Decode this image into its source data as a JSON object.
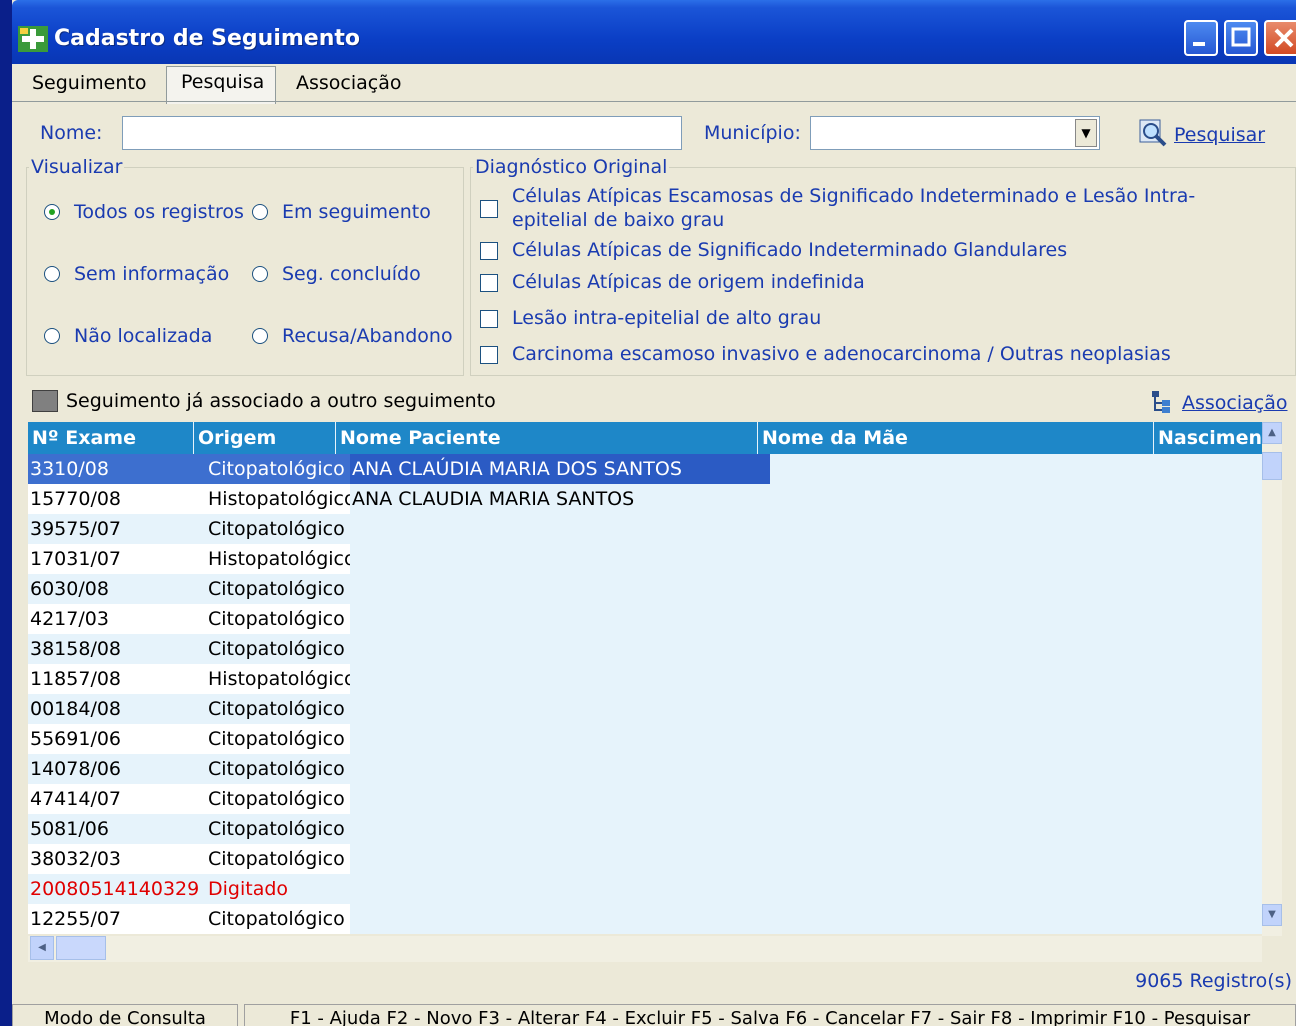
{
  "window": {
    "title": "Cadastro de Seguimento"
  },
  "tabs": [
    {
      "label": "Seguimento",
      "active": false
    },
    {
      "label": "Pesquisa",
      "active": true
    },
    {
      "label": "Associação",
      "active": false
    }
  ],
  "search": {
    "name_label": "Nome:",
    "name_value": "",
    "municipio_label": "Município:",
    "municipio_value": "",
    "search_button": "Pesquisar"
  },
  "visualizar": {
    "legend": "Visualizar",
    "options": [
      {
        "label": "Todos os registros",
        "selected": true
      },
      {
        "label": "Em seguimento",
        "selected": false
      },
      {
        "label": "Sem informação",
        "selected": false
      },
      {
        "label": "Seg. concluído",
        "selected": false
      },
      {
        "label": "Não localizada",
        "selected": false
      },
      {
        "label": "Recusa/Abandono",
        "selected": false
      }
    ]
  },
  "diagnostico": {
    "legend": "Diagnóstico Original",
    "options": [
      {
        "label": "Células Atípicas Escamosas de Significado Indeterminado e Lesão Intra-epitelial de baixo grau",
        "checked": false
      },
      {
        "label": "Células Atípicas de Significado Indeterminado Glandulares",
        "checked": false
      },
      {
        "label": "Células Atípicas de origem indefinida",
        "checked": false
      },
      {
        "label": "Lesão intra-epitelial de alto grau",
        "checked": false
      },
      {
        "label": "Carcinoma escamoso invasivo e adenocarcinoma / Outras neoplasias",
        "checked": false
      }
    ]
  },
  "legend_note": "Seguimento já associado a outro seguimento",
  "association_link": "Associação",
  "grid": {
    "columns": [
      "Nº Exame",
      "Origem",
      "Nome Paciente",
      "Nome da Mãe",
      "Nascimen"
    ],
    "rows": [
      {
        "exame": "3310/08",
        "origem": "Citopatológico",
        "paciente": "ANA CLAÚDIA MARIA DOS SANTOS"
      },
      {
        "exame": "15770/08",
        "origem": "Histopatológico",
        "paciente": "ANA CLAUDIA MARIA SANTOS"
      },
      {
        "exame": "39575/07",
        "origem": "Citopatológico",
        "paciente": ""
      },
      {
        "exame": "17031/07",
        "origem": "Histopatológico",
        "paciente": ""
      },
      {
        "exame": "6030/08",
        "origem": "Citopatológico",
        "paciente": ""
      },
      {
        "exame": "4217/03",
        "origem": "Citopatológico",
        "paciente": ""
      },
      {
        "exame": "38158/08",
        "origem": "Citopatológico",
        "paciente": ""
      },
      {
        "exame": "11857/08",
        "origem": "Histopatológico",
        "paciente": ""
      },
      {
        "exame": "00184/08",
        "origem": "Citopatológico",
        "paciente": ""
      },
      {
        "exame": "55691/06",
        "origem": "Citopatológico",
        "paciente": ""
      },
      {
        "exame": "14078/06",
        "origem": "Citopatológico",
        "paciente": ""
      },
      {
        "exame": "47414/07",
        "origem": "Citopatológico",
        "paciente": ""
      },
      {
        "exame": "5081/06",
        "origem": "Citopatológico",
        "paciente": ""
      },
      {
        "exame": "38032/03",
        "origem": "Citopatológico",
        "paciente": ""
      },
      {
        "exame": "20080514140329",
        "origem": "Digitado",
        "paciente": "",
        "highlight": "red"
      },
      {
        "exame": "12255/07",
        "origem": "Citopatológico",
        "paciente": ""
      }
    ]
  },
  "record_count": "9065 Registro(s)",
  "statusbar": {
    "mode": "Modo de Consulta",
    "shortcuts": "F1 - Ajuda F2 - Novo F3 - Alterar F4 - Excluir F5 - Salva F6 - Cancelar F7 - Sair F8 - Imprimir F10 - Pesquisar"
  },
  "colors": {
    "title_bar": "#0b3fc6",
    "grid_header": "#1e87c8",
    "selected_row": "#3d6fcf",
    "label_text": "#1a3bb0",
    "alert_text": "#e00000"
  }
}
